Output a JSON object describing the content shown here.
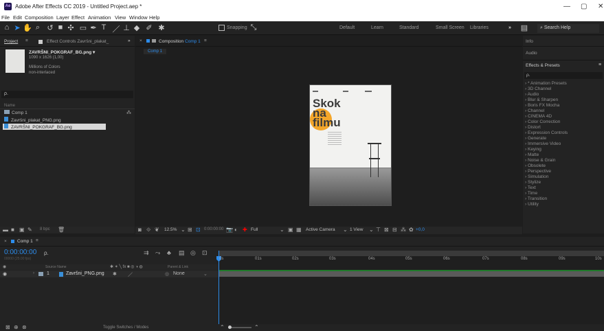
{
  "window": {
    "title": "Adobe After Effects CC 2019 - Untitled Project.aep *",
    "app_icon": "Ae",
    "minimize": "—",
    "maximize": "▢",
    "close": "✕"
  },
  "menu": [
    "File",
    "Edit",
    "Composition",
    "Layer",
    "Effect",
    "Animation",
    "View",
    "Window",
    "Help"
  ],
  "toolbar": {
    "snapping_label": "Snapping",
    "workspaces": [
      "Default",
      "Learn",
      "Standard",
      "Small Screen",
      "Libraries"
    ],
    "more_label": "»",
    "search_placeholder": "Search Help"
  },
  "project_panel": {
    "tab_project": "Project",
    "tab_effect_controls": "Effect Controls Završni_plakat_",
    "more": "»",
    "asset_name": "ZAVRŠNI_POKGRAF_BG.png ▾",
    "asset_dims": "1090 x 1626 (1,00)",
    "asset_colors": "Millions of Colors",
    "asset_interlace": "non-interlaced",
    "search_placeholder": "ρ.",
    "col_name": "Name",
    "items": [
      {
        "name": "Comp 1",
        "type": "comp"
      },
      {
        "name": "Završni_plakat_PNG.png",
        "type": "file"
      },
      {
        "name": "ZAVRŠNI_POKGRAF_BG.png",
        "type": "file"
      }
    ],
    "bpc": "8 bpc"
  },
  "composition_panel": {
    "tab_label": "Composition",
    "tab_comp": "Comp 1",
    "flow_tab": "Comp 1",
    "zoom": "12.5%",
    "timecode": "0:00:00:00",
    "resolution": "Full",
    "camera": "Active Camera",
    "views": "1 View",
    "exposure": "+0,0"
  },
  "poster": {
    "title_line1": "Skok",
    "title_line2": "na",
    "title_line3": "filmu"
  },
  "right_panel": {
    "info": "Info",
    "audio": "Audio",
    "effects_title": "Effects & Presets",
    "search_placeholder": "ρ.",
    "items": [
      "* Animation Presets",
      "3D Channel",
      "Audio",
      "Blur & Sharpen",
      "Boris FX Mocha",
      "Channel",
      "CINEMA 4D",
      "Color Correction",
      "Distort",
      "Expression Controls",
      "Generate",
      "Immersive Video",
      "Keying",
      "Matte",
      "Noise & Grain",
      "Obsolete",
      "Perspective",
      "Simulation",
      "Stylize",
      "Text",
      "Time",
      "Transition",
      "Utility"
    ]
  },
  "timeline": {
    "tab": "Comp 1",
    "timecode": "0:00:00:00",
    "fps": "00000 (25.00 fps)",
    "search_placeholder": "ρ.",
    "col_source": "Source Name",
    "col_parent": "Parent & Link",
    "layer_number": "1",
    "layer_name": "Završni_PNG.png",
    "parent_value": "None",
    "ruler": [
      "0s",
      "01s",
      "02s",
      "03s",
      "04s",
      "05s",
      "06s",
      "07s",
      "08s",
      "09s",
      "10s"
    ],
    "footer_label": "Toggle Switches / Modes"
  }
}
